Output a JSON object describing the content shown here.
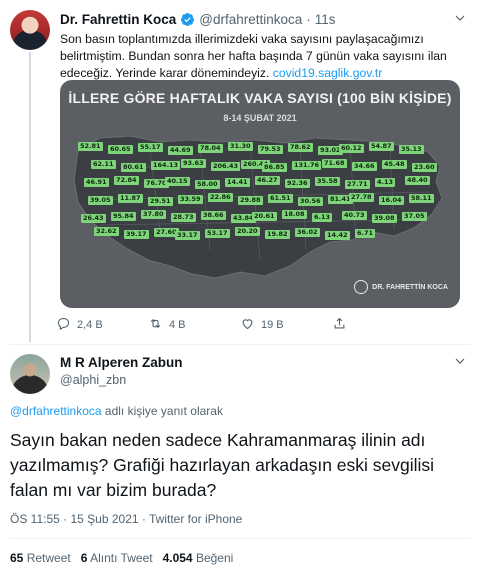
{
  "parent_tweet": {
    "author_name": "Dr. Fahrettin Koca",
    "handle": "@drfahrettinkoca",
    "separator": "·",
    "time": "11s",
    "text_line1": "Son basın toplantımızda illerimizdeki  vaka sayısını paylaşacağımızı",
    "text_line2": "belirtmiştim. Bundan sonra her hafta başında 7 günün vaka sayısını ilan",
    "text_line3": "edeceğiz. Yerinde karar dönemindeyiz.",
    "link": "covid19.saglik.gov.tr",
    "media": {
      "title": "İLLERE GÖRE HAFTALIK VAKA SAYISI (100 BİN KİŞİDE)",
      "subtitle": "8-14 ŞUBAT 2021",
      "logo_text": "DR. FAHRETTİN KOCA",
      "map_labels": [
        "52.81",
        "60.65",
        "55.17",
        "44.69",
        "78.04",
        "31.30",
        "79.53",
        "78.62",
        "93.02",
        "60.12",
        "54.87",
        "35.13",
        "62.11",
        "80.61",
        "164.13",
        "93.63",
        "206.43",
        "260.44",
        "86.85",
        "131.76",
        "71.68",
        "34.66",
        "45.48",
        "23.60",
        "46.91",
        "72.84",
        "76.70",
        "40.15",
        "58.00",
        "14.41",
        "46.27",
        "92.36",
        "35.58",
        "27.71",
        "4.13",
        "48.40",
        "39.05",
        "11.87",
        "29.51",
        "33.59",
        "22.86",
        "29.88",
        "61.51",
        "30.56",
        "81.41",
        "27.78",
        "16.04",
        "58.11",
        "26.43",
        "95.84",
        "37.80",
        "28.73",
        "38.66",
        "43.84",
        "20.61",
        "18.08",
        "6.13",
        "40.73",
        "39.08",
        "37.05",
        "32.62",
        "39.17",
        "27.60",
        "33.17",
        "53.17",
        "20.20",
        "19.82",
        "36.02",
        "14.42",
        "6.71"
      ]
    },
    "actions": {
      "reply_count": "2,4 B",
      "retweet_count": "4 B",
      "like_count": "19 B"
    }
  },
  "reply_tweet": {
    "author_name": "M R Alperen Zabun",
    "handle": "@alphi_zbn",
    "replying_to_handle": "@drfahrettinkoca",
    "replying_to_suffix": " adlı kişiye yanıt olarak",
    "text": "Sayın bakan neden sadece Kahramanmaraş ilinin adı yazılmamış? Grafiği hazırlayan arkadaşın eski sevgilisi falan mı var bizim burada?",
    "meta": "ÖS 11:55 · 15 Şub 2021 · Twitter for iPhone",
    "stats": {
      "retweets_num": "65",
      "retweets_label": "Retweet",
      "quotes_num": "6",
      "quotes_label": "Alıntı Tweet",
      "likes_num": "4.054",
      "likes_label": "Beğeni"
    }
  },
  "colors": {
    "accent": "#1d9bf0",
    "secondary_text": "#536471",
    "map_fill": "#7fd37a"
  }
}
